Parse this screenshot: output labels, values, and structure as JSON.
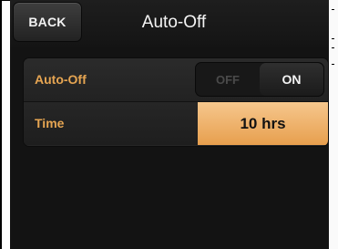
{
  "header": {
    "back_label": "BACK",
    "title": "Auto-Off"
  },
  "settings": {
    "auto_off": {
      "label": "Auto-Off",
      "off_label": "OFF",
      "on_label": "ON",
      "selected": "ON"
    },
    "time": {
      "label": "Time",
      "value": "10 hrs"
    }
  },
  "colors": {
    "accent": "#e6a552",
    "highlight": "#f0b56e",
    "background": "#131313"
  }
}
